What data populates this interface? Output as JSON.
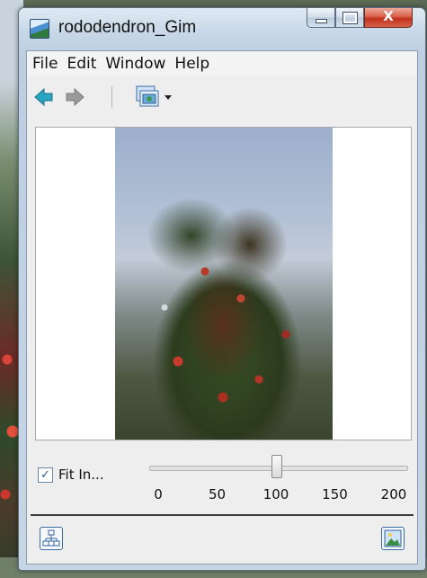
{
  "window": {
    "title": "rododendron_Gim",
    "close_glyph": "X"
  },
  "menubar": {
    "items": [
      "File",
      "Edit",
      "Window",
      "Help"
    ]
  },
  "toolbar": {
    "icons": [
      "back-arrow-icon",
      "forward-arrow-icon",
      "view-mode-icon",
      "dropdown-arrow-icon"
    ]
  },
  "zoom": {
    "fit_label": "Fit In...",
    "fit_checked": true,
    "fit_check_glyph": "✓",
    "ticks": [
      "0",
      "50",
      "100",
      "150",
      "200"
    ],
    "value": 100,
    "min": 0,
    "max": 200
  },
  "colors": {
    "accent": "#2f7fd0",
    "close_red": "#c2311c"
  }
}
